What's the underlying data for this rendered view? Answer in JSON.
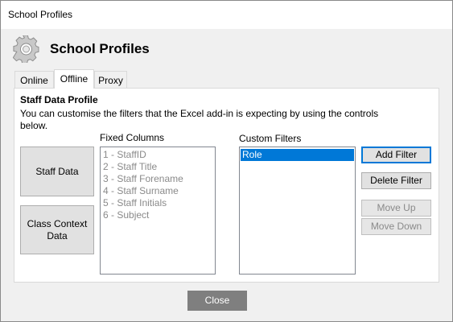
{
  "window": {
    "title": "School Profiles"
  },
  "header": {
    "title": "School Profiles",
    "icon": "gear-icon"
  },
  "tabs": [
    {
      "label": "Online",
      "active": false
    },
    {
      "label": "Offline",
      "active": true
    },
    {
      "label": "Proxy",
      "active": false
    }
  ],
  "panel": {
    "section_title": "Staff Data Profile",
    "description": "You can customise the filters that the Excel add-in is expecting by using the controls below.",
    "profile_buttons": [
      "Staff Data",
      "Class Context Data"
    ],
    "fixed_columns": {
      "label": "Fixed Columns",
      "items": [
        "1 - StaffID",
        "2 - Staff Title",
        "3 - Staff Forename",
        "4 - Staff Surname",
        "5 - Staff Initials",
        "6 - Subject"
      ]
    },
    "custom_filters": {
      "label": "Custom Filters",
      "items": [
        "Role"
      ],
      "selected": "Role"
    },
    "actions": {
      "add_filter": "Add Filter",
      "delete_filter": "Delete Filter",
      "move_up": "Move Up",
      "move_down": "Move Down"
    }
  },
  "footer": {
    "close_label": "Close"
  },
  "colors": {
    "selection": "#0078d7",
    "close_button": "#7f7f7f",
    "disabled_text": "#8a8a8a"
  }
}
